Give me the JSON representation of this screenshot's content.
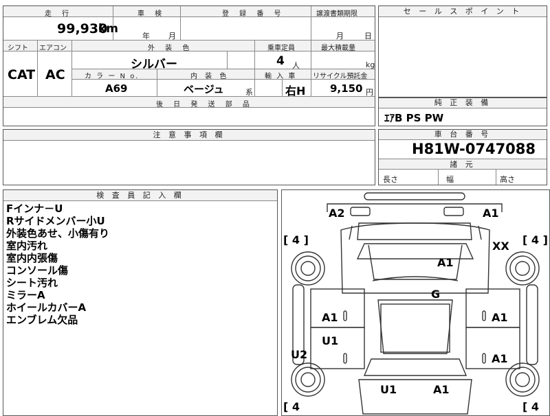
{
  "spec": {
    "mileage_label": "走 行",
    "mileage": "99,930",
    "mileage_unit": "km",
    "inspection_label": "車 検",
    "year_unit": "年",
    "month_unit": "月",
    "registration_label": "登 録 番 号",
    "transfer_label": "譲渡書類期限",
    "transfer_month": "月",
    "transfer_day": "日",
    "shift_label": "シフト",
    "shift": "CAT",
    "ac_label": "エアコン",
    "ac": "AC",
    "exterior_color_label": "外 装 色",
    "exterior_color": "シルバー",
    "capacity_label": "乗車定員",
    "capacity": "4",
    "capacity_unit": "人",
    "max_load_label": "最大積載量",
    "max_load_unit": "kg",
    "color_no_label": "カ ラ ー N o.",
    "color_no": "A69",
    "interior_label": "内 装 色",
    "interior": "ベージュ",
    "interior_suffix": "系",
    "import_label": "輸 入 車",
    "handle": "右H",
    "recycle_label": "リサイクル預託金",
    "recycle_amount": "9,150",
    "recycle_unit": "円",
    "later_parts_label": "後 日 発 送 部 品"
  },
  "sales_point": {
    "label": "セ ー ル ス ポ イ ン ト"
  },
  "genuine": {
    "label": "純 正 装 備",
    "value": "ｴｱB PS PW"
  },
  "caution": {
    "label": "注 意 事 項 欄"
  },
  "chassis": {
    "label": "車 台 番 号",
    "value": "H81W-0747088",
    "dims_label": "諸 元",
    "length": "長さ",
    "width": "幅",
    "height": "高さ"
  },
  "inspector": {
    "label": "検 査 員 記 入 欄",
    "notes": [
      "Fインナ－U",
      "Rサイドメンバー小U",
      "外装色あせ、小傷有り",
      "室内汚れ",
      "室内内張傷",
      "コンソール傷",
      "シート汚れ",
      "ミラーA",
      "ホイールカバーA",
      "エンブレム欠品"
    ]
  },
  "diagram": {
    "tire_fl": "[ 4 ]",
    "tire_fr": "[ 4 ]",
    "tire_rl": "[ 4",
    "tire_rr": "[ 4",
    "front_left": "A2",
    "front_right": "A1",
    "fender_right": "XX",
    "hood": "A1",
    "roof": "G",
    "door_fl": "A1",
    "door_fr": "A1",
    "door_rl": "U1",
    "door_rr": "A1",
    "side_left": "U2",
    "rear_left": "U1",
    "rear_right": "A1"
  }
}
